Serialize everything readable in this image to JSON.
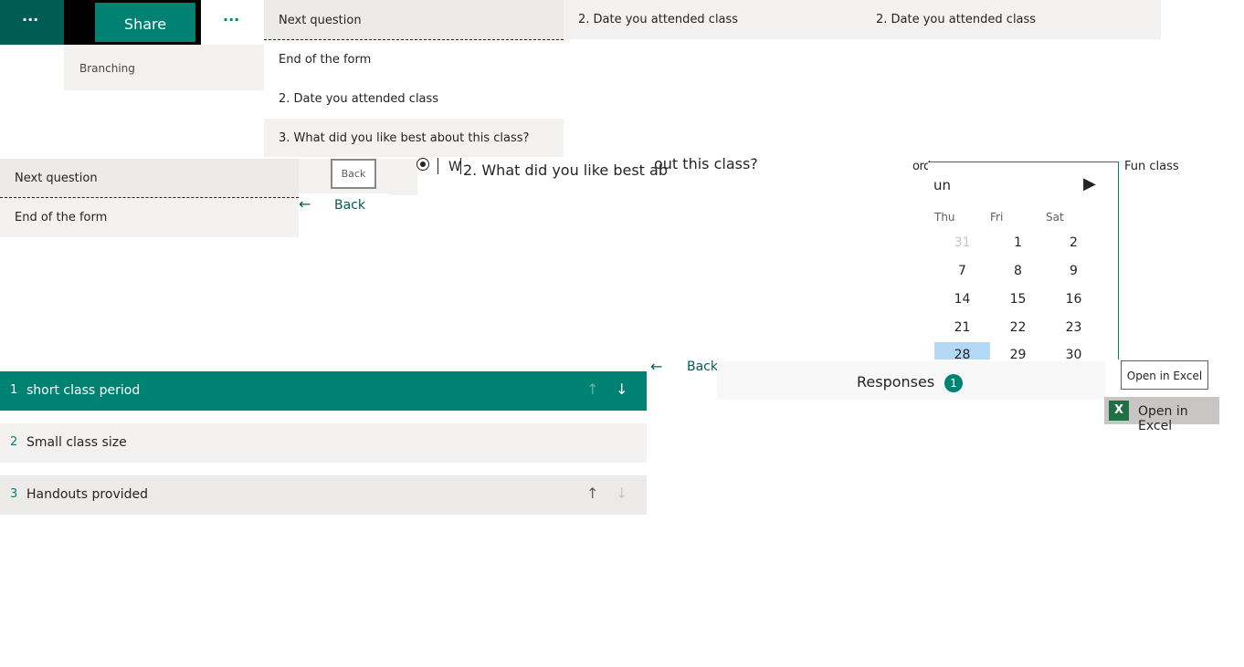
{
  "topbar": {
    "more_left": "···",
    "share": "Share",
    "more_right": "···"
  },
  "branching_label": "Branching",
  "dropdown_main": {
    "items": [
      "Next question",
      "End of the form",
      "2. Date you attended class",
      "3. What did you like best about this class?"
    ]
  },
  "dropdown_left": {
    "items": [
      "Next question",
      "End of the form"
    ]
  },
  "header_strip": {
    "label_a": "2. Date you attended class",
    "label_b": "2. Date you attended class"
  },
  "back_small": "Back",
  "back_link": "Back",
  "back_link2": "Back",
  "question_input_partial": "W",
  "question_text": "2. What did you like best ab",
  "question_text_tail": "out this class?",
  "glitch_left": "ord",
  "glitch_right": "Fun class",
  "calendar": {
    "month_partial": "un",
    "weekdays": [
      "Thu",
      "Fri",
      "Sat"
    ],
    "weeks": [
      [
        "31",
        "1",
        "2"
      ],
      [
        "7",
        "8",
        "9"
      ],
      [
        "14",
        "15",
        "16"
      ],
      [
        "21",
        "22",
        "23"
      ],
      [
        "28",
        "29",
        "30"
      ]
    ]
  },
  "ranking": {
    "rows": [
      {
        "num": "1",
        "label": "short class period"
      },
      {
        "num": "2",
        "label": "Small class size"
      },
      {
        "num": "3",
        "label": "Handouts provided"
      }
    ]
  },
  "responses": {
    "label": "Responses",
    "count": "1"
  },
  "excel": {
    "outline": "Open in Excel",
    "filled": "Open in Excel"
  },
  "colors": {
    "accent": "#008272",
    "panel_gray": "#f3f2f1",
    "calendar_selected": "#b3d9f7"
  }
}
